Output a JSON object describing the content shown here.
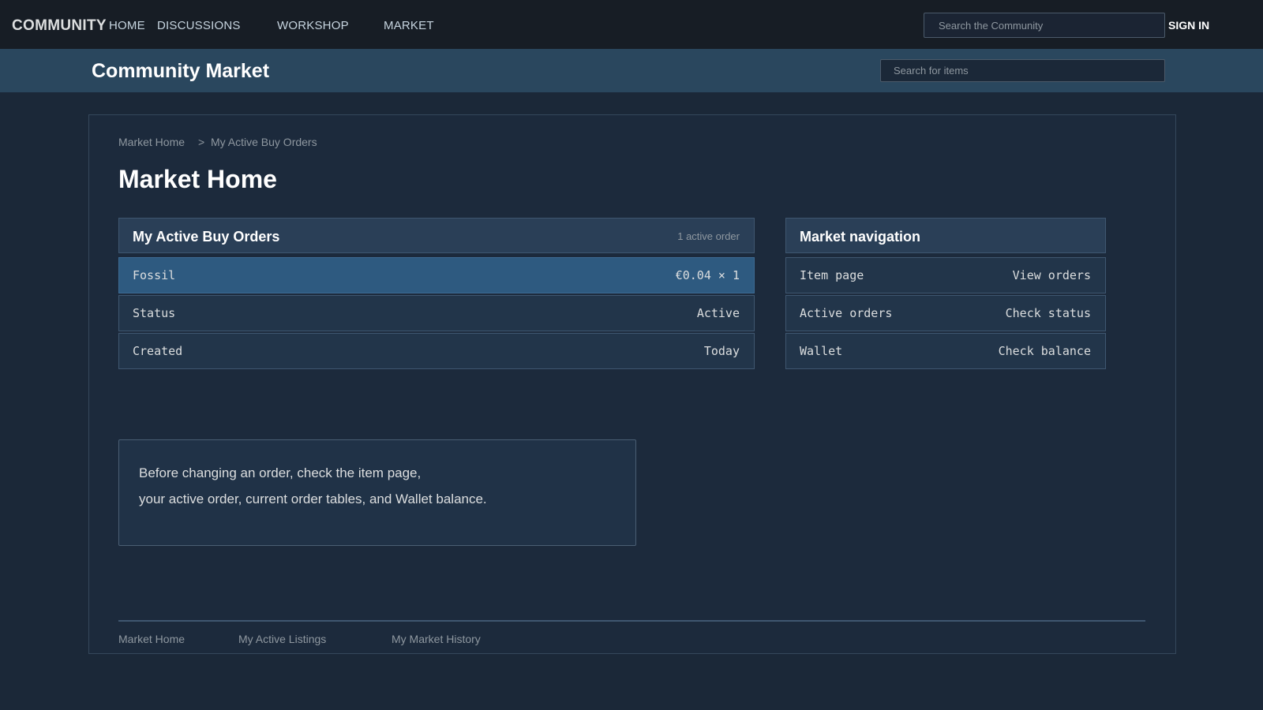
{
  "topnav": {
    "brand": "COMMUNITY",
    "links": [
      "HOME",
      "DISCUSSIONS",
      "WORKSHOP",
      "MARKET"
    ],
    "search_placeholder": "Search the Community",
    "signin_label": "SIGN IN"
  },
  "subheader": {
    "title": "Community Market",
    "search_placeholder": "Search for items"
  },
  "breadcrumb": {
    "items": [
      "Market Home",
      "My Active Buy Orders"
    ],
    "separator": ">"
  },
  "page_title": "Market Home",
  "buy_orders": {
    "title": "My Active Buy Orders",
    "count_label": "1 active order",
    "rows": [
      {
        "label": "Fossil",
        "value": "€0.04 × 1"
      },
      {
        "label": "Status",
        "value": "Active"
      },
      {
        "label": "Created",
        "value": "Today"
      }
    ]
  },
  "market_nav": {
    "title": "Market navigation",
    "rows": [
      {
        "label": "Item page",
        "value": "View orders"
      },
      {
        "label": "Active orders",
        "value": "Check status"
      },
      {
        "label": "Wallet",
        "value": "Check balance"
      }
    ]
  },
  "note": {
    "lines": [
      "Before changing an order, check the item page,",
      "your active order, current order tables, and Wallet balance."
    ]
  },
  "footer": {
    "links": [
      "Market Home",
      "My Active Listings",
      "My Market History"
    ]
  },
  "colors": {
    "page_bg": "#1b2838",
    "topbar_bg": "#171d25",
    "subbar_bg": "#2a475e",
    "highlight_row": "#2e5a80"
  }
}
